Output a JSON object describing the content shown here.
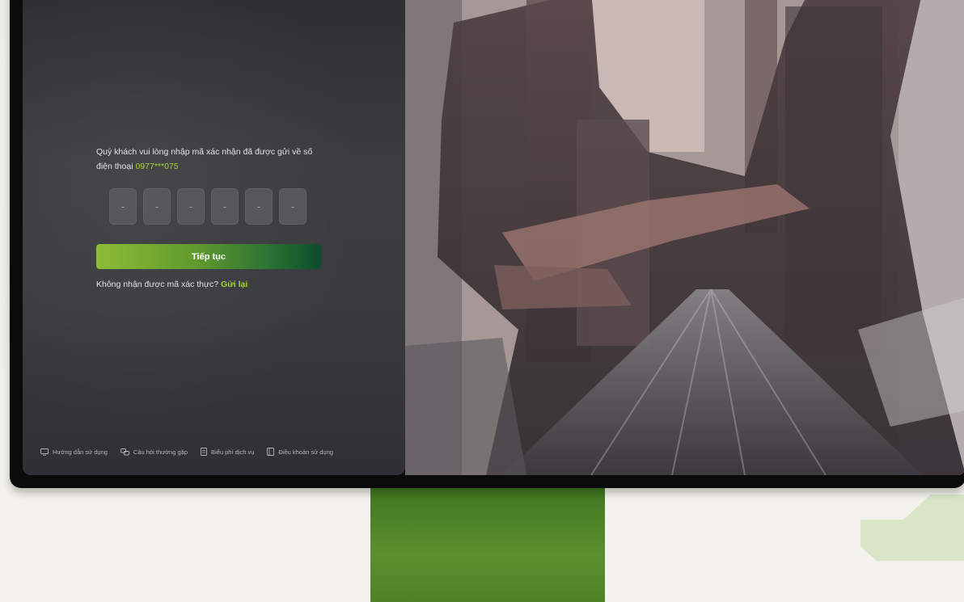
{
  "otp": {
    "message_prefix": "Quý khách vui lòng nhập mã xác nhận đã được gửi về số điện thoại ",
    "phone_masked": "0977***075",
    "digits": [
      "-",
      "-",
      "-",
      "-",
      "-",
      "-"
    ]
  },
  "continue_button": {
    "label": "Tiếp tục"
  },
  "resend": {
    "prompt": "Không nhận được mã xác thực? ",
    "link_label": "Gửi lại"
  },
  "footer": {
    "links": [
      {
        "label": "Hướng dẫn sử dụng",
        "icon": "monitor-icon"
      },
      {
        "label": "Câu hỏi thường gặp",
        "icon": "chat-bubbles-icon"
      },
      {
        "label": "Biểu phí dịch vụ",
        "icon": "document-icon"
      },
      {
        "label": "Điều khoản sử dụng",
        "icon": "terms-book-icon"
      }
    ]
  },
  "colors": {
    "accent": "#a9d23b",
    "button_gradient_start": "#8dbc35",
    "button_gradient_end": "#0d4d2c",
    "panel_background": "#333437",
    "stand": "#4f8228"
  }
}
